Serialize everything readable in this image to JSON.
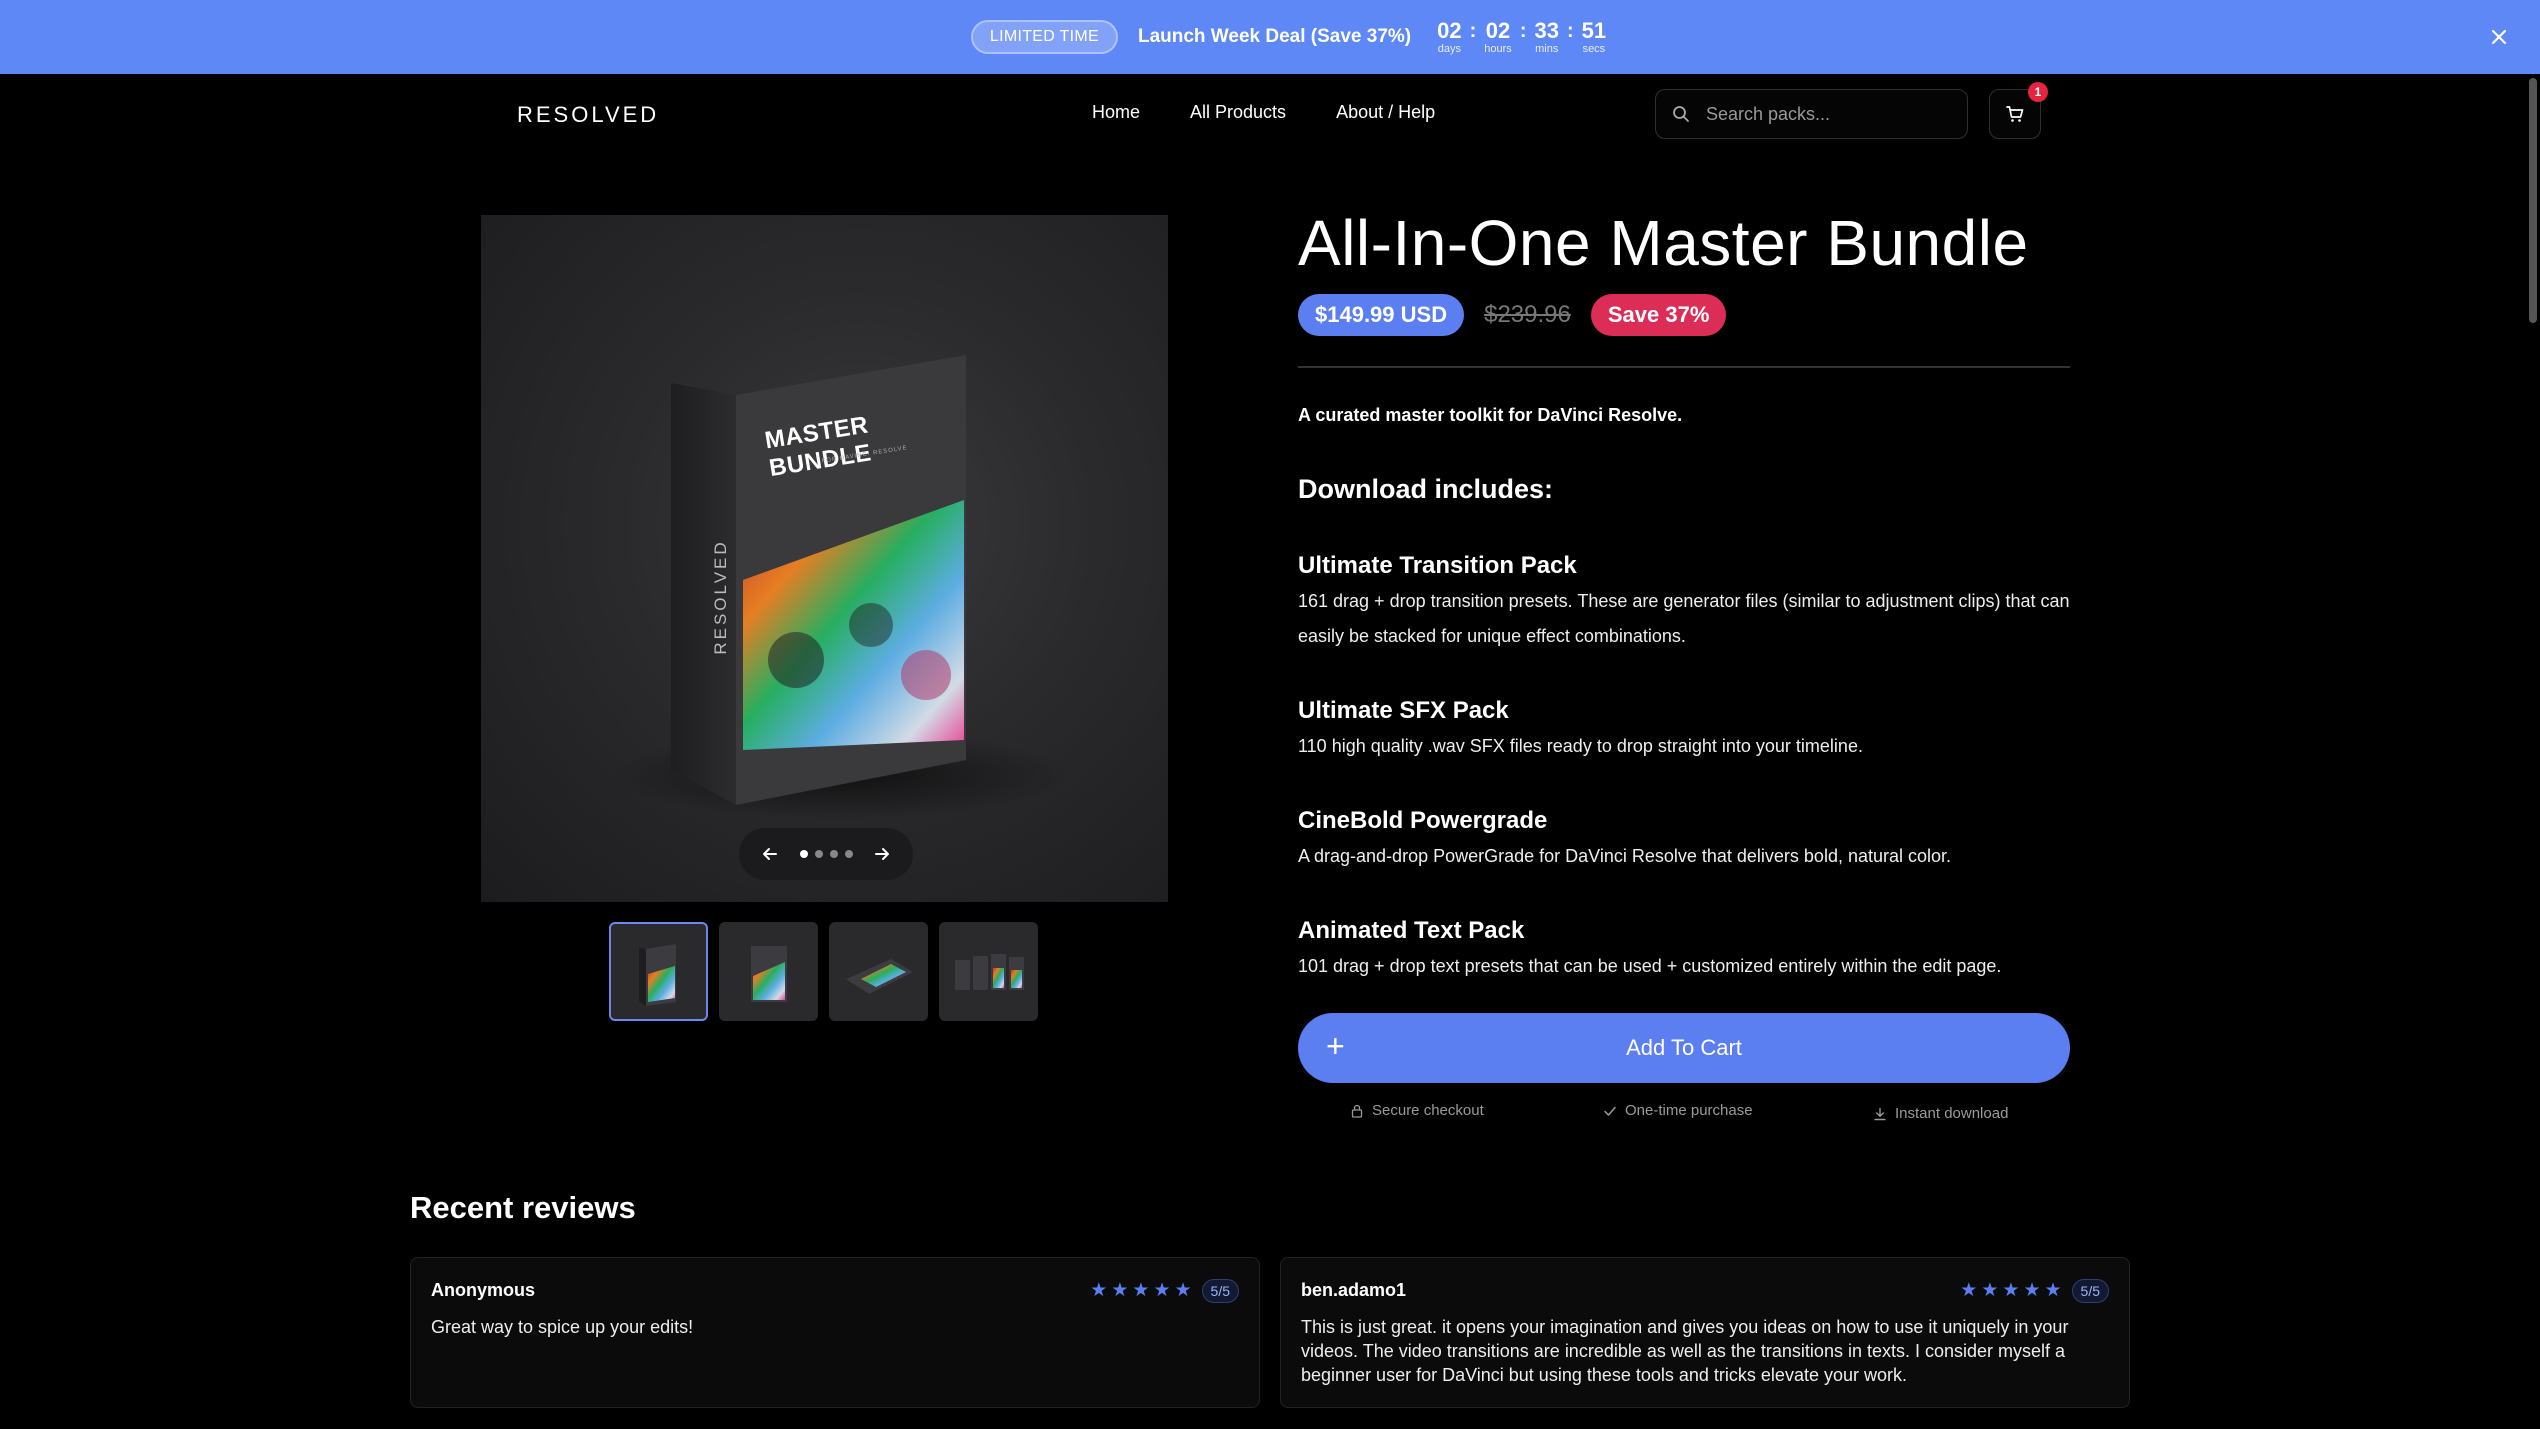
{
  "banner": {
    "badge": "LIMITED TIME",
    "text": "Launch Week Deal (Save 37%)",
    "countdown": [
      {
        "value": "02",
        "label": "days"
      },
      {
        "value": "02",
        "label": "hours"
      },
      {
        "value": "33",
        "label": "mins"
      },
      {
        "value": "51",
        "label": "secs"
      }
    ]
  },
  "header": {
    "logo": "RESOLVED",
    "nav": [
      "Home",
      "All Products",
      "About / Help"
    ],
    "search_placeholder": "Search packs...",
    "cart_count": "1"
  },
  "gallery": {
    "box_title": "MASTER BUNDLE",
    "box_subtitle": "FOR DAVINCI RESOLVE",
    "box_brand": "RESOLVED",
    "thumb_count": 4,
    "active_slide": 1
  },
  "product": {
    "title": "All-In-One Master Bundle",
    "price": "$149.99 USD",
    "old_price": "$239.96",
    "save": "Save 37%",
    "tagline": "A curated master toolkit for DaVinci Resolve.",
    "includes_heading": "Download includes:",
    "packs": [
      {
        "title": "Ultimate Transition Pack",
        "desc": "161 drag + drop transition presets. These are generator files (similar to adjustment clips) that can easily be stacked for unique effect combinations."
      },
      {
        "title": "Ultimate SFX Pack",
        "desc": "110 high quality .wav SFX files ready to drop straight into your timeline."
      },
      {
        "title": "CineBold Powergrade",
        "desc": "A drag-and-drop PowerGrade for DaVinci Resolve that delivers bold, natural color."
      },
      {
        "title": "Animated Text Pack",
        "desc": "101 drag + drop text presets that can be used + customized entirely within the edit page."
      }
    ],
    "add_to_cart": "Add To Cart",
    "trust": [
      "Secure checkout",
      "One-time purchase",
      "Instant download"
    ]
  },
  "reviews": {
    "heading": "Recent reviews",
    "items": [
      {
        "author": "Anonymous",
        "rating": "5/5",
        "stars": 5,
        "text": "Great way to spice up your edits!"
      },
      {
        "author": "ben.adamo1",
        "rating": "5/5",
        "stars": 5,
        "text": "This is just great. it opens your imagination and gives you ideas on how to use it uniquely in your videos. The video transitions are incredible as well as the transitions in texts. I consider myself a beginner user for DaVinci but using these tools and tricks elevate your work."
      }
    ]
  },
  "colors": {
    "accent": "#5b7ff0",
    "banner": "#5f88f7",
    "save_badge": "#dc2d56",
    "background": "#000000"
  }
}
